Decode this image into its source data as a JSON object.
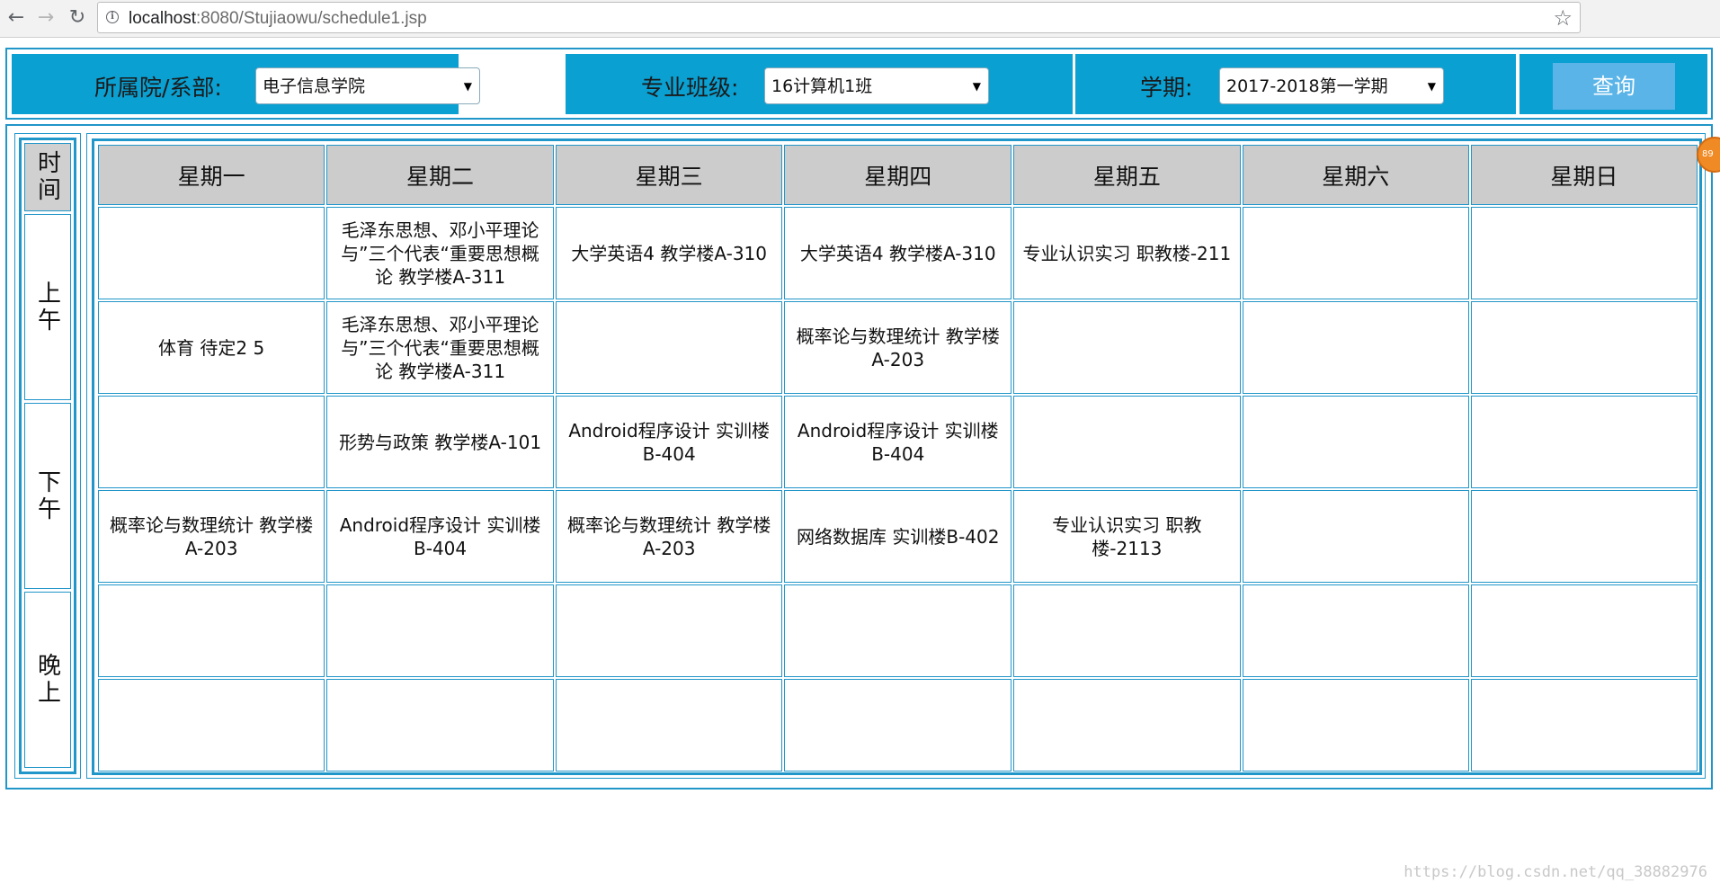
{
  "browser": {
    "url_host": "localhost",
    "url_path": ":8080/Stujiaowu/schedule1.jsp"
  },
  "filters": {
    "dept_label": "所属院/系部:",
    "dept_value": "电子信息学院",
    "class_label": "专业班级:",
    "class_value": "16计算机1班",
    "term_label": "学期:",
    "term_value": "2017-2018第一学期",
    "query_label": "查询"
  },
  "time_col": {
    "header": "时间",
    "morning": "上午",
    "afternoon": "下午",
    "evening": "晚上"
  },
  "days": [
    "星期一",
    "星期二",
    "星期三",
    "星期四",
    "星期五",
    "星期六",
    "星期日"
  ],
  "rows": [
    [
      "",
      "毛泽东思想、邓小平理论与”三个代表“重要思想概论 教学楼A-311",
      "大学英语4 教学楼A-310",
      "大学英语4 教学楼A-310",
      "专业认识实习 职教楼-211",
      "",
      ""
    ],
    [
      "体育 待定2 5",
      "毛泽东思想、邓小平理论与”三个代表“重要思想概论 教学楼A-311",
      "",
      "概率论与数理统计 教学楼A-203",
      "",
      "",
      ""
    ],
    [
      "",
      "形势与政策 教学楼A-101",
      "Android程序设计 实训楼B-404",
      "Android程序设计 实训楼B-404",
      "",
      "",
      ""
    ],
    [
      "概率论与数理统计 教学楼A-203",
      "Android程序设计 实训楼B-404",
      "概率论与数理统计 教学楼A-203",
      "网络数据库 实训楼B-402",
      "专业认识实习 职教楼-2113",
      "",
      ""
    ],
    [
      "",
      "",
      "",
      "",
      "",
      "",
      ""
    ],
    [
      "",
      "",
      "",
      "",
      "",
      "",
      ""
    ]
  ],
  "watermark": "https://blog.csdn.net/qq_38882976",
  "badge": "89",
  "icons": {
    "back": "arrow-left-icon",
    "forward": "arrow-right-icon",
    "reload": "reload-icon",
    "info": "info-icon",
    "star": "star-icon",
    "dropdown": "caret-down-icon"
  },
  "colors": {
    "accent": "#0aa0d2",
    "border": "#2196c9",
    "query_button": "#5ab4e8",
    "header_bg": "#cccccc"
  }
}
